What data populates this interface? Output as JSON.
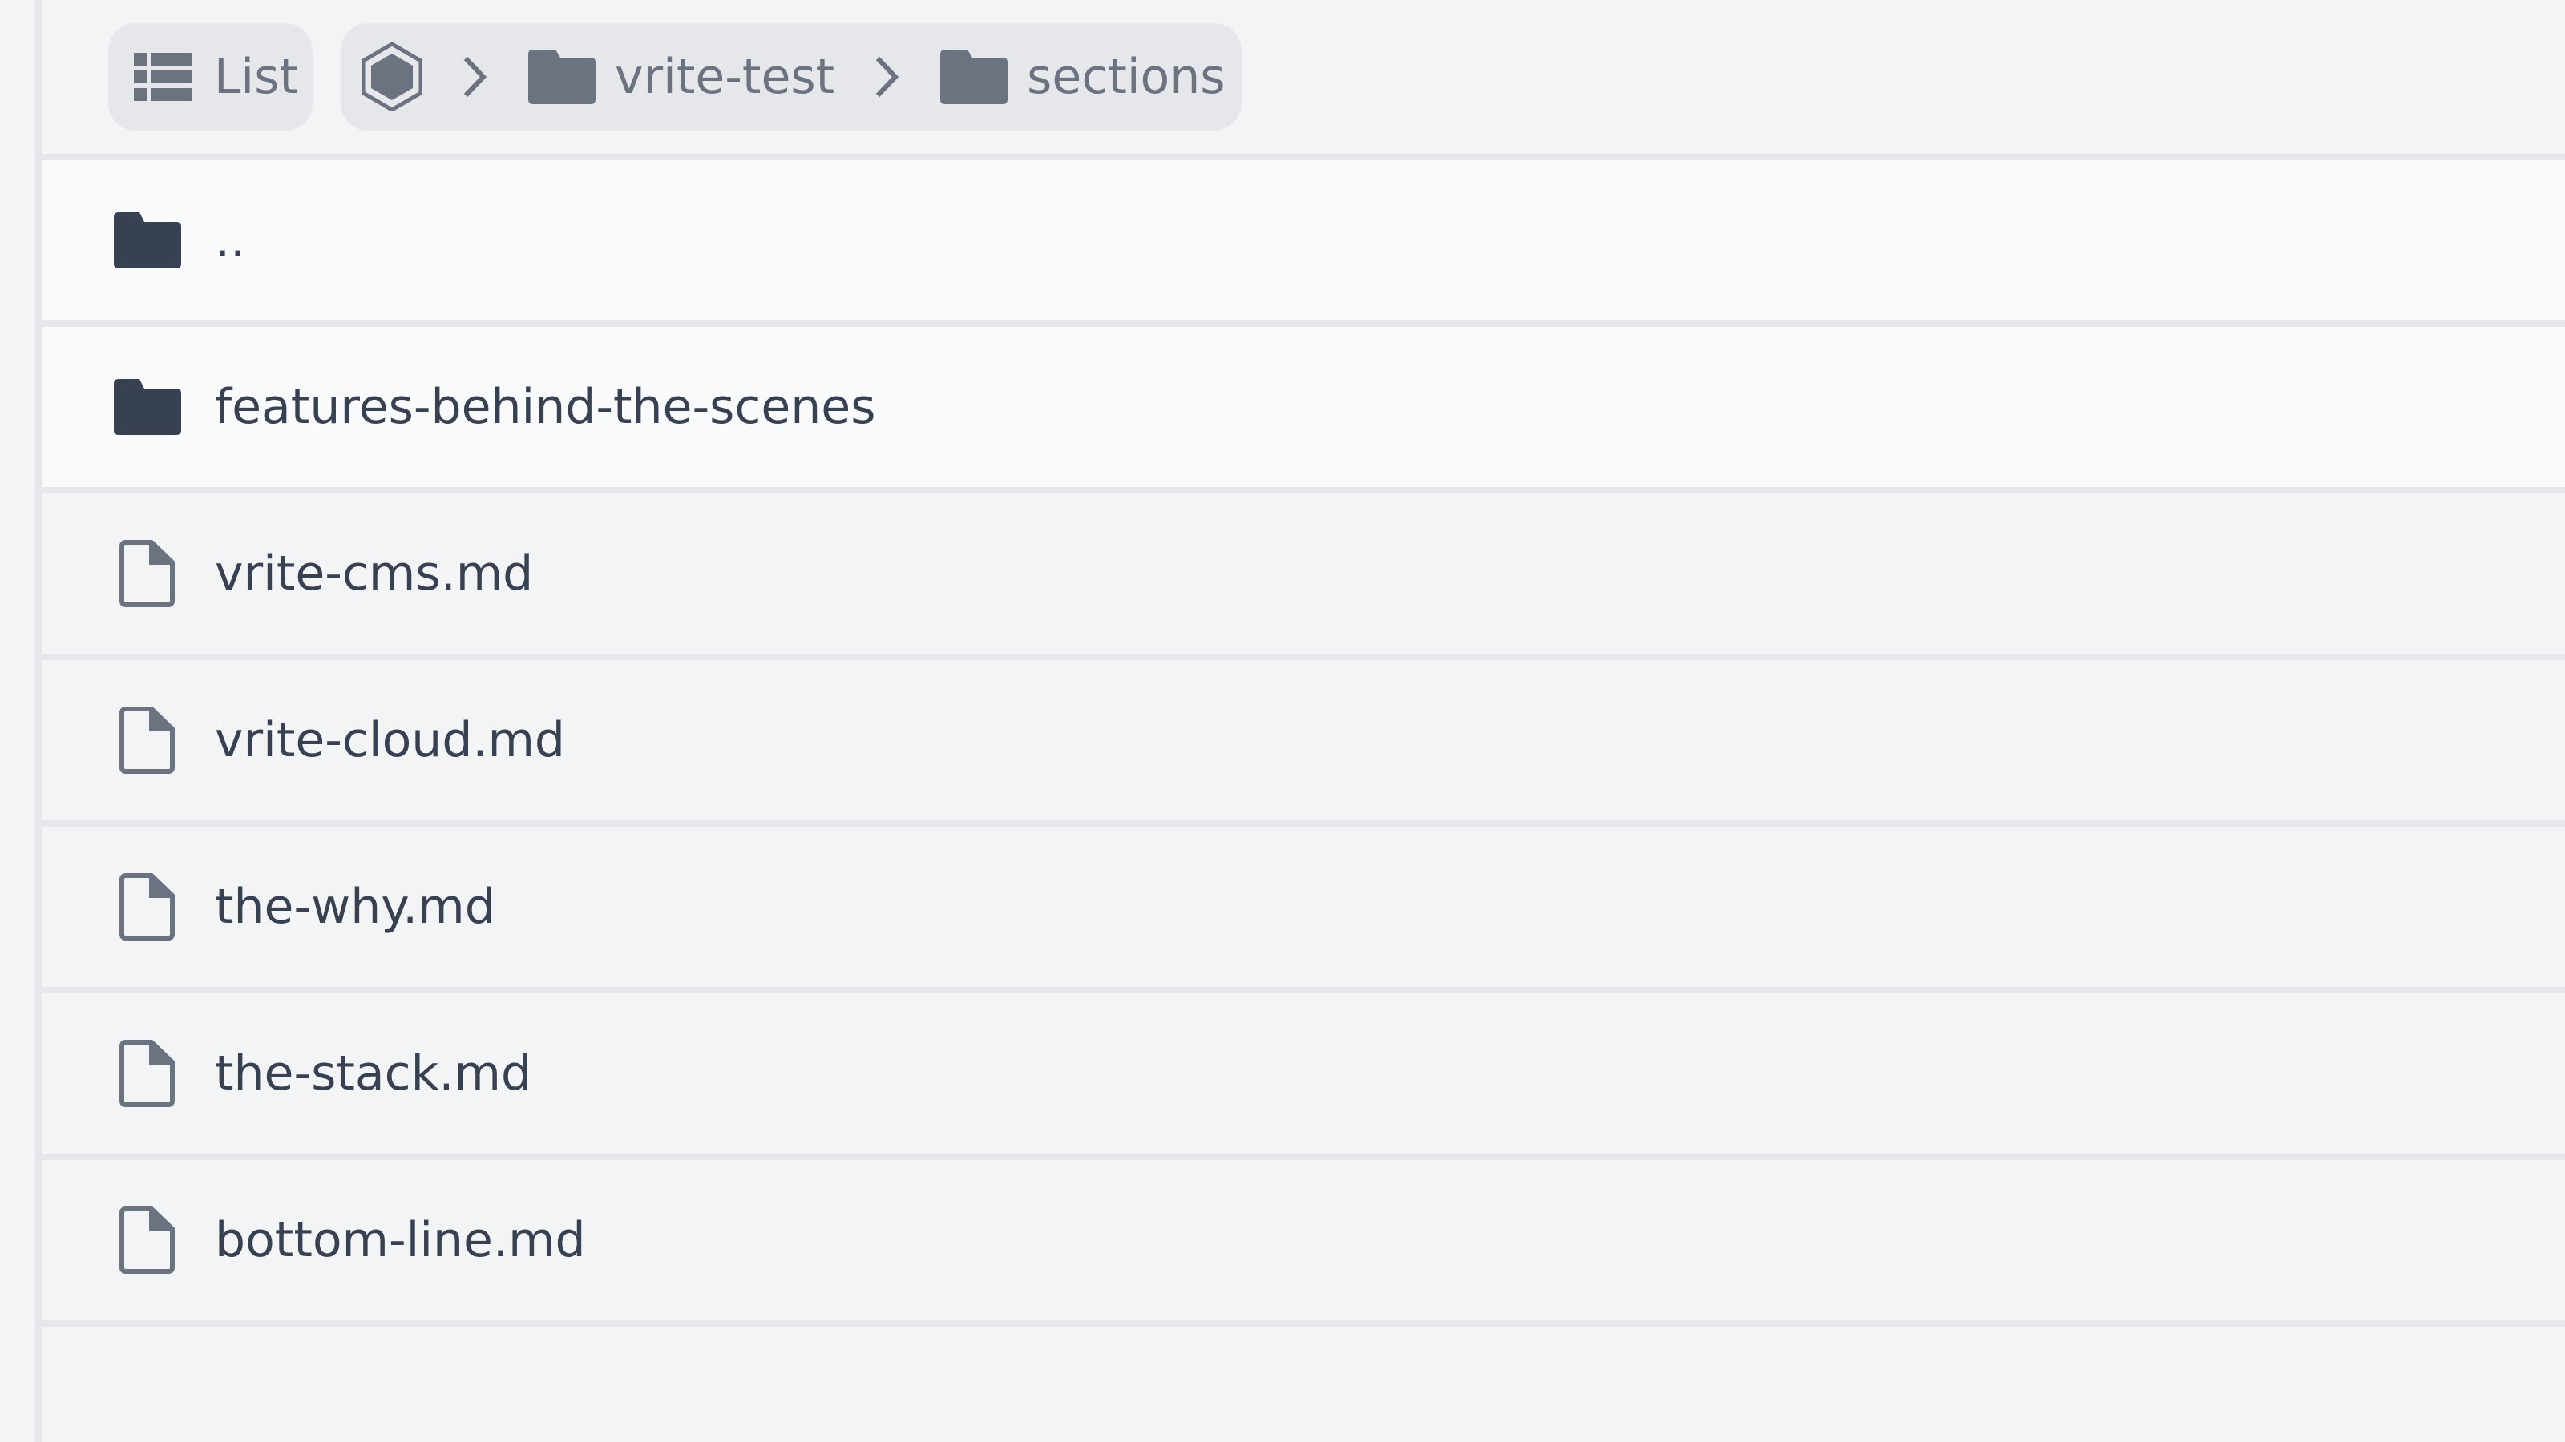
{
  "toolbar": {
    "view_toggle": {
      "icon": "list-icon",
      "label": "List"
    },
    "breadcrumb": {
      "root_icon": "hexagon-icon",
      "separator_icon": "chevron-right-icon",
      "items": [
        {
          "icon": "folder-icon",
          "label": "vrite-test"
        },
        {
          "icon": "folder-icon",
          "label": "sections"
        }
      ]
    }
  },
  "file_list": {
    "items": [
      {
        "type": "folder",
        "icon": "folder-icon",
        "name": ".."
      },
      {
        "type": "folder",
        "icon": "folder-icon",
        "name": "features-behind-the-scenes"
      },
      {
        "type": "file",
        "icon": "file-icon",
        "name": "vrite-cms.md"
      },
      {
        "type": "file",
        "icon": "file-icon",
        "name": "vrite-cloud.md"
      },
      {
        "type": "file",
        "icon": "file-icon",
        "name": "the-why.md"
      },
      {
        "type": "file",
        "icon": "file-icon",
        "name": "the-stack.md"
      },
      {
        "type": "file",
        "icon": "file-icon",
        "name": "bottom-line.md"
      }
    ]
  },
  "colors": {
    "background": "#f3f4f6",
    "folder_row_background": "#f9fafb",
    "divider": "#e5e7eb",
    "pill_background": "#e5e7eb",
    "muted_text": "#6b7280",
    "primary_text": "#374151",
    "folder_icon": "#374151",
    "file_icon": "#6b7280"
  }
}
